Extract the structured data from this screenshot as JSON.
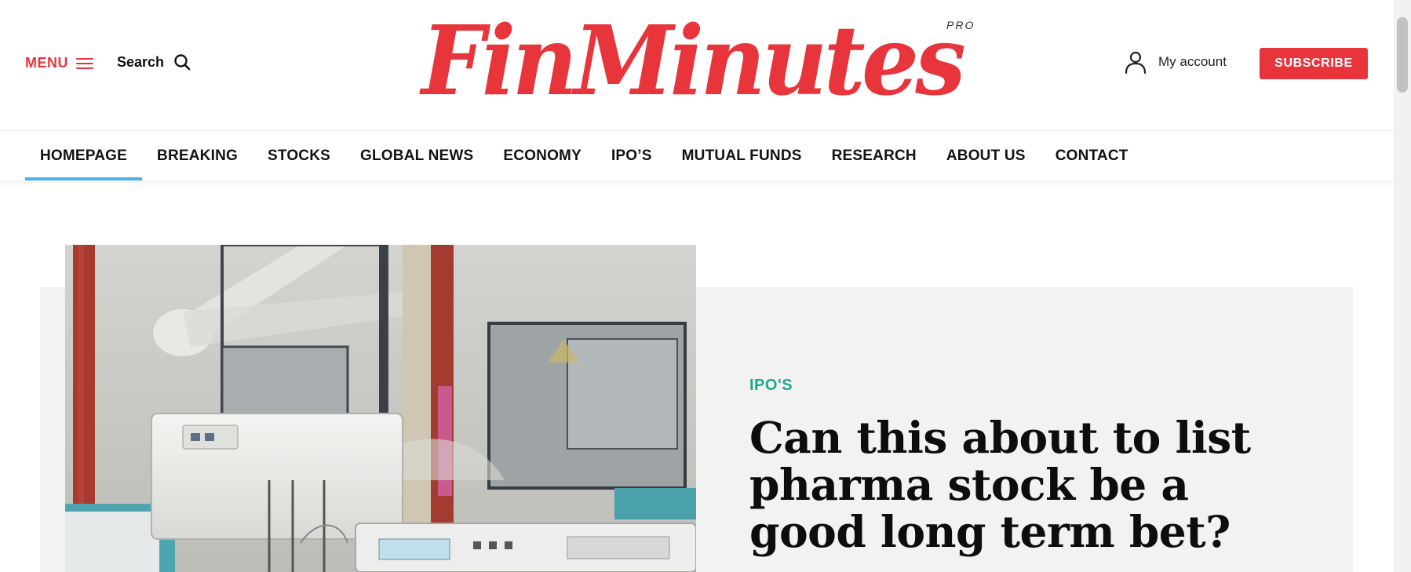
{
  "header": {
    "menu_label": "MENU",
    "search_label": "Search",
    "logo_text": "FinMinutes",
    "logo_badge": "PRO",
    "account_label": "My account",
    "subscribe_label": "SUBSCRIBE"
  },
  "nav": {
    "items": [
      {
        "label": "HOMEPAGE",
        "active": true
      },
      {
        "label": "BREAKING"
      },
      {
        "label": "STOCKS"
      },
      {
        "label": "GLOBAL NEWS"
      },
      {
        "label": "ECONOMY"
      },
      {
        "label": "IPO’S"
      },
      {
        "label": "MUTUAL FUNDS"
      },
      {
        "label": "RESEARCH"
      },
      {
        "label": "ABOUT US"
      },
      {
        "label": "CONTACT"
      }
    ]
  },
  "featured": {
    "category": "IPO'S",
    "title": "Can this about to list pharma stock be a good long term bet?"
  },
  "colors": {
    "brand": "#e8353b",
    "nav_active": "#4db2ec",
    "category": "#1fa98a",
    "feature_bg": "#f2f2f2"
  },
  "icons": {
    "menu": "hamburger-icon",
    "search": "search-icon",
    "account": "user-icon"
  }
}
